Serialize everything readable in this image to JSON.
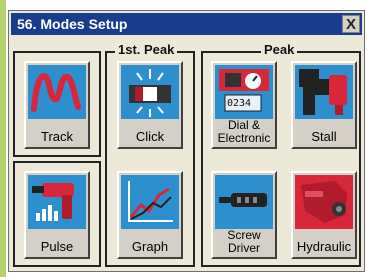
{
  "window": {
    "title": "56. Modes Setup",
    "close_label": "X"
  },
  "groups": {
    "peak1_label": "1st. Peak",
    "peak_label": "Peak"
  },
  "buttons": {
    "track": "Track",
    "click": "Click",
    "pulse": "Pulse",
    "graph": "Graph",
    "dial_line1": "Dial &",
    "dial_line2": "Electronic",
    "dial_readout": "0234",
    "stall": "Stall",
    "screw_line1": "Screw",
    "screw_line2": "Driver",
    "hydraulic": "Hydraulic"
  },
  "colors": {
    "icon_bg": "#2e8fce",
    "accent_red": "#d8263a",
    "titlebar": "#1a3c8c"
  }
}
